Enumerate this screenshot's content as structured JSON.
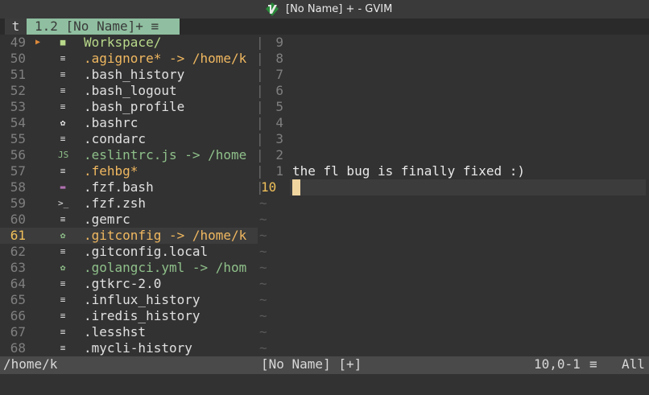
{
  "window": {
    "title": "[No Name] + - GVIM"
  },
  "tabline": {
    "tab_t": "t",
    "tab_label": "1.2 [No Name]+ ≡"
  },
  "tree": {
    "items": [
      {
        "num": "49",
        "icon": "folder",
        "name": "Workspace/",
        "color": "#b8d98a",
        "arrow": true
      },
      {
        "num": "50",
        "icon": "file",
        "name": ".agignore* -> /home/k",
        "color": "#f0b860"
      },
      {
        "num": "51",
        "icon": "file",
        "name": ".bash_history",
        "color": "#e0e0e0"
      },
      {
        "num": "52",
        "icon": "file",
        "name": ".bash_logout",
        "color": "#e0e0e0"
      },
      {
        "num": "53",
        "icon": "file",
        "name": ".bash_profile",
        "color": "#e0e0e0"
      },
      {
        "num": "54",
        "icon": "gear",
        "name": ".bashrc",
        "color": "#e0e0e0"
      },
      {
        "num": "55",
        "icon": "file",
        "name": ".condarc",
        "color": "#e0e0e0"
      },
      {
        "num": "56",
        "icon": "js",
        "name": ".eslintrc.js -> /home",
        "color": "#8fc08a"
      },
      {
        "num": "57",
        "icon": "file",
        "name": ".fehbg*",
        "color": "#f0b860"
      },
      {
        "num": "58",
        "icon": "shell",
        "name": ".fzf.bash",
        "color": "#e0e0e0"
      },
      {
        "num": "59",
        "icon": "terminal",
        "name": ".fzf.zsh",
        "color": "#e0e0e0"
      },
      {
        "num": "60",
        "icon": "file",
        "name": ".gemrc",
        "color": "#e0e0e0"
      },
      {
        "num": "61",
        "icon": "gear-green",
        "name": ".gitconfig -> /home/k",
        "color": "#f0b860",
        "current": true
      },
      {
        "num": "62",
        "icon": "file",
        "name": ".gitconfig.local",
        "color": "#e0e0e0"
      },
      {
        "num": "63",
        "icon": "gear-green",
        "name": ".golangci.yml -> /hom",
        "color": "#8fc08a"
      },
      {
        "num": "64",
        "icon": "file",
        "name": ".gtkrc-2.0",
        "color": "#e0e0e0"
      },
      {
        "num": "65",
        "icon": "file",
        "name": ".influx_history",
        "color": "#e0e0e0"
      },
      {
        "num": "66",
        "icon": "file",
        "name": ".iredis_history",
        "color": "#e0e0e0"
      },
      {
        "num": "67",
        "icon": "file",
        "name": ".lesshst",
        "color": "#e0e0e0"
      },
      {
        "num": "68",
        "icon": "file",
        "name": ".mycli-history",
        "color": "#e0e0e0"
      }
    ]
  },
  "buffer": {
    "rel_numbers": [
      "9",
      "8",
      "7",
      "6",
      "5",
      "4",
      "3",
      "2",
      "1"
    ],
    "current_line": "10",
    "text_line": "the fl bug is finally fixed :)",
    "tilde": "~"
  },
  "statusline": {
    "left": "/home/k",
    "center": "[No Name] [+]",
    "position": "10,0-1",
    "menu_glyph": "≡",
    "percent": "All"
  },
  "colors": {
    "accent": "#f0c05a",
    "tab_active": "#8fbfa0"
  }
}
